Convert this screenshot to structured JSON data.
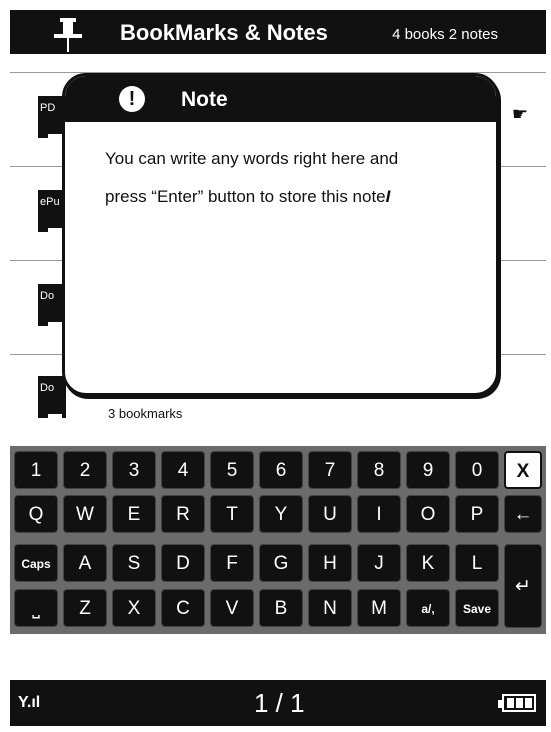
{
  "header": {
    "title": "BookMarks & Notes",
    "count": "4 books 2 notes"
  },
  "books": [
    {
      "label": "PD"
    },
    {
      "label": "ePu"
    },
    {
      "label": "Do"
    },
    {
      "label": "Do"
    }
  ],
  "book_meta": {
    "bookmarks": "3 bookmarks"
  },
  "note": {
    "title": "Note",
    "warn_glyph": "!",
    "line1": "You can write any words right here and",
    "line2": "press “Enter” button to store this note",
    "caret": "I"
  },
  "keyboard": {
    "row1": [
      "1",
      "2",
      "3",
      "4",
      "5",
      "6",
      "7",
      "8",
      "9",
      "0"
    ],
    "close": "X",
    "row2": [
      "Q",
      "W",
      "E",
      "R",
      "T",
      "Y",
      "U",
      "I",
      "O",
      "P"
    ],
    "backspace": "←",
    "caps": "Caps",
    "row3": [
      "A",
      "S",
      "D",
      "F",
      "G",
      "H",
      "J",
      "K",
      "L"
    ],
    "space": "⎵",
    "row4": [
      "Z",
      "X",
      "C",
      "V",
      "B",
      "N",
      "M"
    ],
    "punct": "a/,",
    "save": "Save",
    "enter": "↵"
  },
  "footer": {
    "signal": "Y.ıl",
    "page": "1 / 1"
  }
}
